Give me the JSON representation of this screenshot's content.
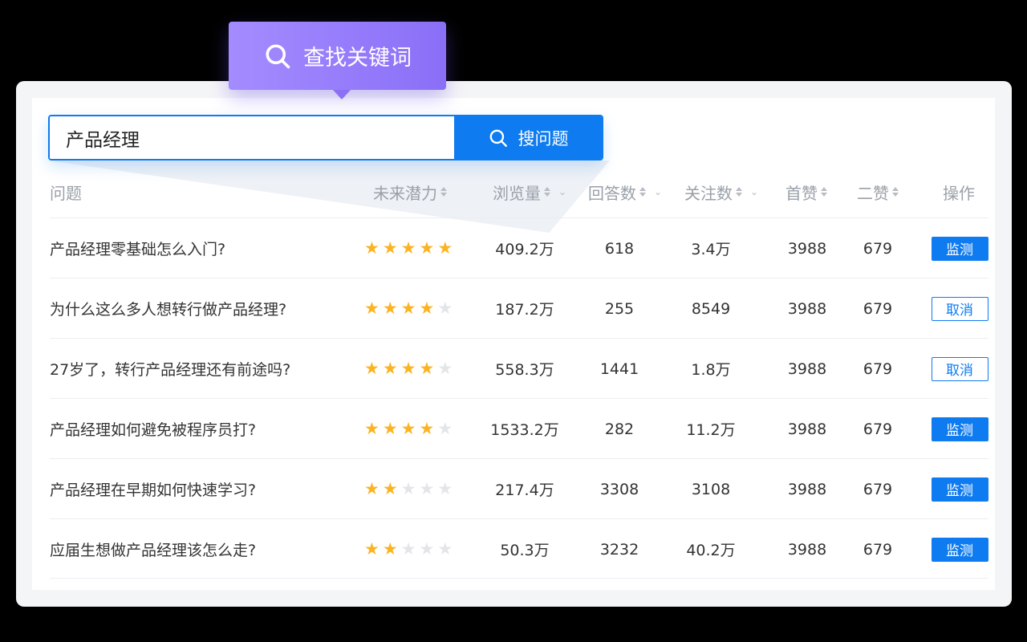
{
  "tooltip": {
    "label": "查找关键词"
  },
  "search": {
    "value": "产品经理",
    "button_label": "搜问题"
  },
  "colors": {
    "accent": "#0e7bf0",
    "tooltip": "#9a80fb",
    "star_on": "#fbb321",
    "star_off": "#e3e5e8"
  },
  "table": {
    "headers": {
      "question": "问题",
      "potential": "未来潜力",
      "views": "浏览量",
      "answers": "回答数",
      "followers": "关注数",
      "first_like": "首赞",
      "second_like": "二赞",
      "action": "操作"
    },
    "rows": [
      {
        "question": "产品经理零基础怎么入门?",
        "stars": 5,
        "views": "409.2万",
        "answers": "618",
        "followers": "3.4万",
        "first_like": "3988",
        "second_like": "679",
        "action": "监测",
        "action_type": "monitor"
      },
      {
        "question": "为什么这么多人想转行做产品经理?",
        "stars": 4,
        "views": "187.2万",
        "answers": "255",
        "followers": "8549",
        "first_like": "3988",
        "second_like": "679",
        "action": "取消",
        "action_type": "cancel"
      },
      {
        "question": "27岁了，转行产品经理还有前途吗?",
        "stars": 4,
        "views": "558.3万",
        "answers": "1441",
        "followers": "1.8万",
        "first_like": "3988",
        "second_like": "679",
        "action": "取消",
        "action_type": "cancel"
      },
      {
        "question": "产品经理如何避免被程序员打?",
        "stars": 4,
        "views": "1533.2万",
        "answers": "282",
        "followers": "11.2万",
        "first_like": "3988",
        "second_like": "679",
        "action": "监测",
        "action_type": "monitor"
      },
      {
        "question": "产品经理在早期如何快速学习?",
        "stars": 2,
        "views": "217.4万",
        "answers": "3308",
        "followers": "3108",
        "first_like": "3988",
        "second_like": "679",
        "action": "监测",
        "action_type": "monitor"
      },
      {
        "question": "应届生想做产品经理该怎么走?",
        "stars": 2,
        "views": "50.3万",
        "answers": "3232",
        "followers": "40.2万",
        "first_like": "3988",
        "second_like": "679",
        "action": "监测",
        "action_type": "monitor"
      }
    ]
  }
}
